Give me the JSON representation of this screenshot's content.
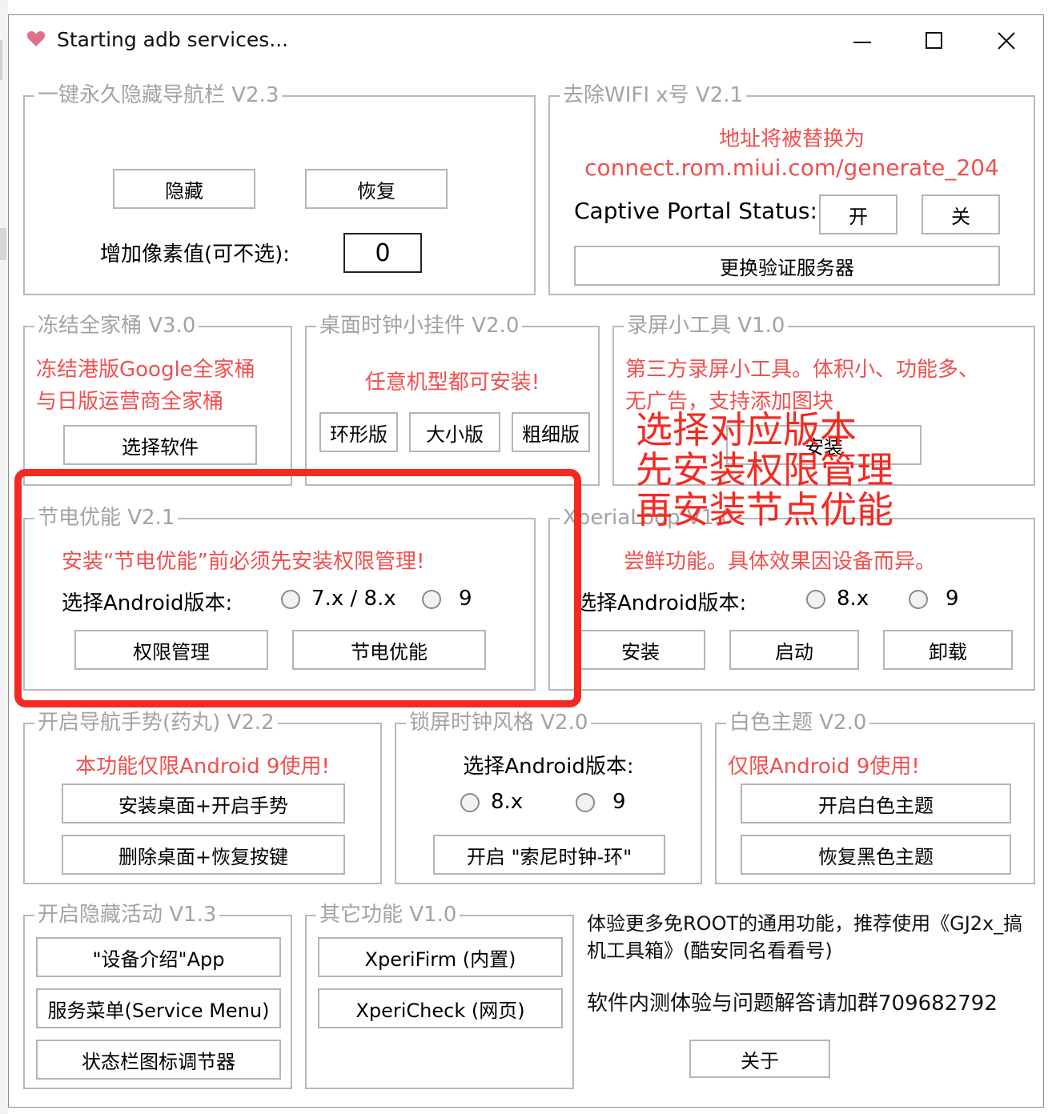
{
  "window": {
    "title": "Starting adb services...",
    "app_icon": "heart-icon",
    "controls": [
      "minimize-icon",
      "maximize-icon",
      "close-icon"
    ]
  },
  "nav": {
    "title": "一键永久隐藏导航栏 V2.3",
    "hide": "隐藏",
    "restore": "恢复",
    "pixel_label": "增加像素值(可不选):",
    "pixel_value": "0"
  },
  "wifi": {
    "title": "去除WIFI x号 V2.1",
    "note_line1": "地址将被替换为",
    "note_line2": "connect.rom.miui.com/generate_204",
    "status_label": "Captive Portal Status:",
    "on": "开",
    "off": "关",
    "change_server": "更换验证服务器"
  },
  "freeze": {
    "title": "冻结全家桶 V3.0",
    "note_line1": "冻结港版Google全家桶",
    "note_line2": "与日版运营商全家桶",
    "select": "选择软件"
  },
  "clock": {
    "title": "桌面时钟小挂件 V2.0",
    "note": "任意机型都可安装!",
    "ring": "环形版",
    "size": "大小版",
    "weight": "粗细版"
  },
  "recorder": {
    "title": "录屏小工具 V1.0",
    "note_line1": "第三方录屏小工具。体积小、功能多、",
    "note_line2": "无广告，支持添加图块",
    "install": "安装"
  },
  "battery": {
    "title": "节电优能 V2.1",
    "note": "安装“节电优能”前必须先安装权限管理!",
    "version_label": "选择Android版本:",
    "opt1": "7.x / 8.x",
    "opt2": "9",
    "perm": "权限管理",
    "optimize": "节电优能"
  },
  "xperia": {
    "title": "XperiaLoop V1.0",
    "note": "尝鲜功能。具体效果因设备而异。",
    "version_label": "选择Android版本:",
    "opt1": "8.x",
    "opt2": "9",
    "install": "安装",
    "start": "启动",
    "uninstall": "卸载"
  },
  "gesture": {
    "title": "开启导航手势(药丸) V2.2",
    "note": "本功能仅限Android 9使用!",
    "install": "安装桌面+开启手势",
    "remove": "删除桌面+恢复按键"
  },
  "lockclock": {
    "title": "锁屏时钟风格 V2.0",
    "version_label": "选择Android版本:",
    "opt1": "8.x",
    "opt2": "9",
    "enable": "开启 \"索尼时钟-环\""
  },
  "theme": {
    "title": "白色主题 V2.0",
    "note": "仅限Android 9使用!",
    "white": "开启白色主题",
    "black": "恢复黑色主题"
  },
  "hidden": {
    "title": "开启隐藏活动 V1.3",
    "device": "\"设备介绍\"App",
    "service": "服务菜单(Service Menu)",
    "statusbar": "状态栏图标调节器"
  },
  "other": {
    "title": "其它功能 V1.0",
    "firm": "XperiFirm (内置)",
    "check": "XperiCheck (网页)"
  },
  "about": {
    "info_line1": "体验更多免ROOT的通用功能，推荐使用《GJ2x_搞",
    "info_line2": "机工具箱》(酷安同名看看号)",
    "group_line": "软件内测体验与问题解答请加群709682792",
    "about_btn": "关于"
  },
  "annotation": {
    "line1": "选择对应版本",
    "line2": "先安装权限管理",
    "line3": "再安装节点优能"
  },
  "colors": {
    "red_note": "#f05050",
    "highlight": "#f42a22",
    "heart": "#e0708a"
  }
}
